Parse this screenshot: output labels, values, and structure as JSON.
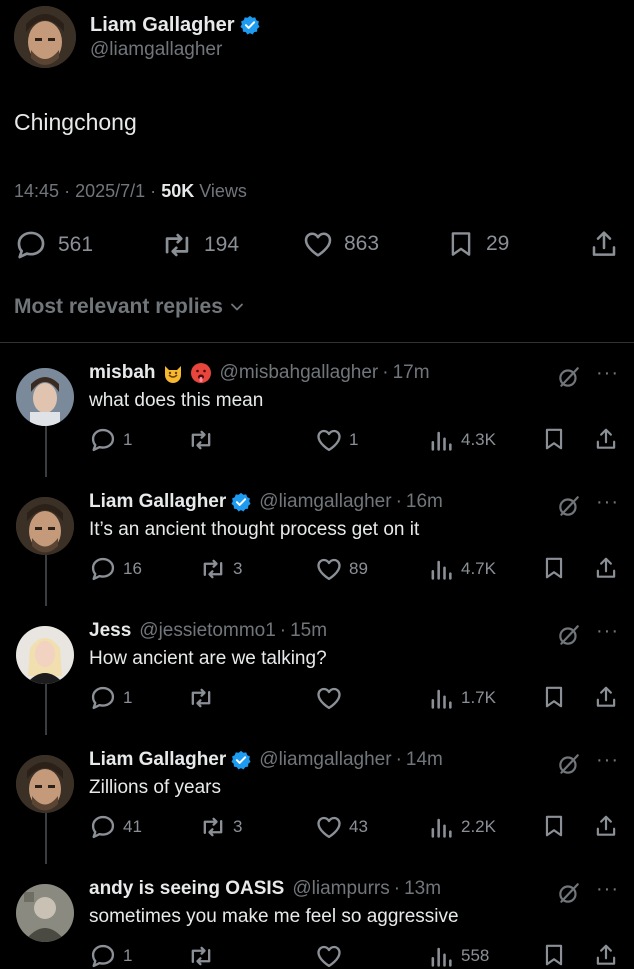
{
  "tweet": {
    "author_name": "Liam Gallagher",
    "author_handle": "@liamgallagher",
    "text": "Chingchong",
    "time": "14:45",
    "date": "2025/7/1",
    "views_count": "50K",
    "views_label": "Views",
    "replies": "561",
    "retweets": "194",
    "likes": "863",
    "bookmarks": "29"
  },
  "sort_label": "Most relevant replies",
  "replies": [
    {
      "name": "misbah",
      "handle": "@misbahgallagher",
      "time": "17m",
      "text": "what does this mean",
      "replies": "1",
      "retweets": "",
      "likes": "1",
      "views": "4.3K",
      "verified": false
    },
    {
      "name": "Liam Gallagher",
      "handle": "@liamgallagher",
      "time": "16m",
      "text": "It’s an ancient thought process get on it",
      "replies": "16",
      "retweets": "3",
      "likes": "89",
      "views": "4.7K",
      "verified": true
    },
    {
      "name": "Jess",
      "handle": "@jessietommo1",
      "time": "15m",
      "text": "How ancient are we talking?",
      "replies": "1",
      "retweets": "",
      "likes": "",
      "views": "1.7K",
      "verified": false
    },
    {
      "name": "Liam Gallagher",
      "handle": "@liamgallagher",
      "time": "14m",
      "text": "Zillions of years",
      "replies": "41",
      "retweets": "3",
      "likes": "43",
      "views": "2.2K",
      "verified": true
    },
    {
      "name": "andy is seeing OASIS",
      "handle": "@liampurrs",
      "time": "13m",
      "text": "sometimes you make me feel so aggressive",
      "replies": "1",
      "retweets": "",
      "likes": "",
      "views": "558",
      "verified": false
    }
  ],
  "separator": "·",
  "more_glyph": "···",
  "colors": {
    "background": "#000000",
    "text": "#e7e9ea",
    "muted": "#71767b",
    "verified": "#1d9bf0",
    "divider": "#2f3336"
  }
}
